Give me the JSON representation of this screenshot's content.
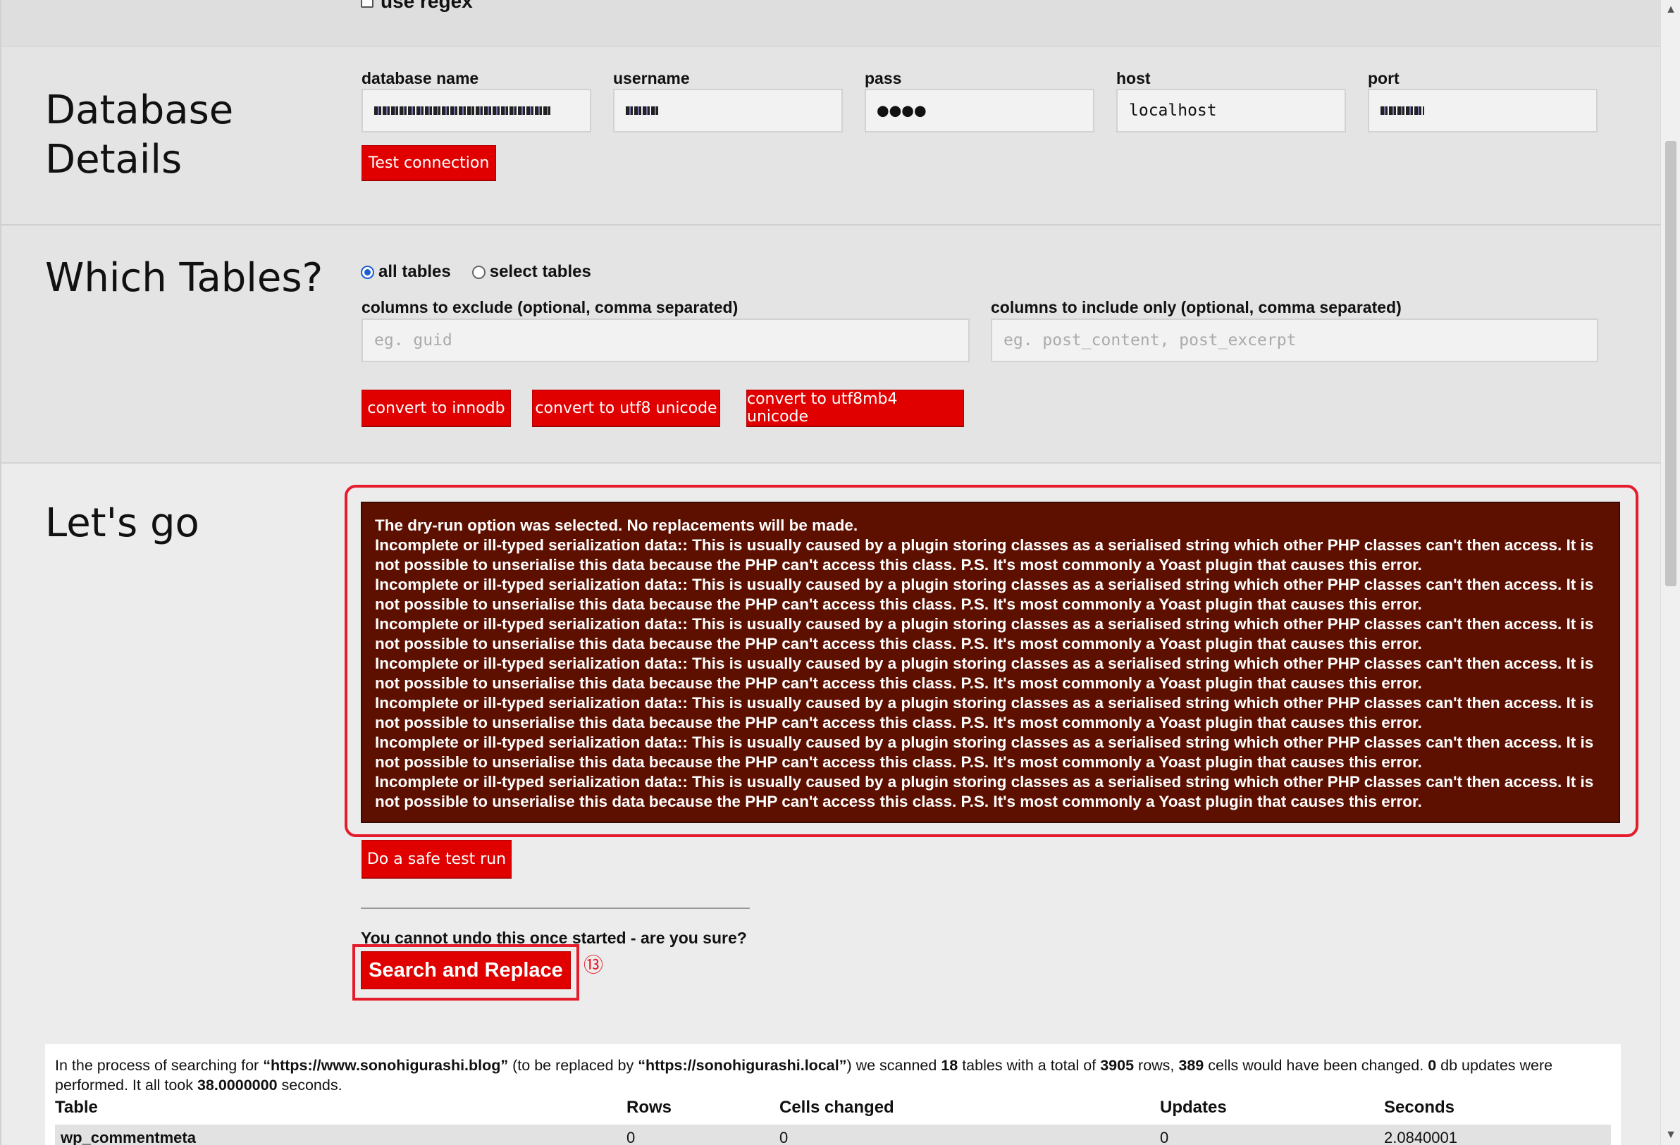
{
  "regex": {
    "label": "use regex"
  },
  "database": {
    "title_line1": "Database",
    "title_line2": "Details",
    "fields": {
      "name_label": "database name",
      "user_label": "username",
      "pass_label": "pass",
      "pass_value": "●●●●",
      "host_label": "host",
      "host_value": "localhost",
      "port_label": "port"
    },
    "test_button": "Test connection"
  },
  "tables": {
    "title": "Which Tables?",
    "radio_all": "all tables",
    "radio_select": "select tables",
    "exclude_label": "columns to exclude (optional, comma separated)",
    "exclude_placeholder": "eg. guid",
    "include_label": "columns to include only (optional, comma separated)",
    "include_placeholder": "eg. post_content, post_excerpt",
    "btn_innodb": "convert to innodb",
    "btn_utf8": "convert to utf8 unicode",
    "btn_utf8mb4": "convert to utf8mb4 unicode"
  },
  "go": {
    "title": "Let's go",
    "messages": [
      "The dry-run option was selected. No replacements will be made.",
      "Incomplete or ill-typed serialization data:: This is usually caused by a plugin storing classes as a serialised string which other PHP classes can't then access. It is not possible to unserialise this data because the PHP can't access this class. P.S. It's most commonly a Yoast plugin that causes this error.",
      "Incomplete or ill-typed serialization data:: This is usually caused by a plugin storing classes as a serialised string which other PHP classes can't then access. It is not possible to unserialise this data because the PHP can't access this class. P.S. It's most commonly a Yoast plugin that causes this error.",
      "Incomplete or ill-typed serialization data:: This is usually caused by a plugin storing classes as a serialised string which other PHP classes can't then access. It is not possible to unserialise this data because the PHP can't access this class. P.S. It's most commonly a Yoast plugin that causes this error.",
      "Incomplete or ill-typed serialization data:: This is usually caused by a plugin storing classes as a serialised string which other PHP classes can't then access. It is not possible to unserialise this data because the PHP can't access this class. P.S. It's most commonly a Yoast plugin that causes this error.",
      "Incomplete or ill-typed serialization data:: This is usually caused by a plugin storing classes as a serialised string which other PHP classes can't then access. It is not possible to unserialise this data because the PHP can't access this class. P.S. It's most commonly a Yoast plugin that causes this error.",
      "Incomplete or ill-typed serialization data:: This is usually caused by a plugin storing classes as a serialised string which other PHP classes can't then access. It is not possible to unserialise this data because the PHP can't access this class. P.S. It's most commonly a Yoast plugin that causes this error.",
      "Incomplete or ill-typed serialization data:: This is usually caused by a plugin storing classes as a serialised string which other PHP classes can't then access. It is not possible to unserialise this data because the PHP can't access this class. P.S. It's most commonly a Yoast plugin that causes this error."
    ],
    "safe_run_button": "Do a safe test run",
    "warning": "You cannot undo this once started - are you sure?",
    "search_replace_button": "Search and Replace",
    "marker": "⑬"
  },
  "report": {
    "t1": "In the process of searching for ",
    "search": "“https://www.sonohigurashi.blog”",
    "t2": " (to be replaced by ",
    "replace": "“https://sonohigurashi.local”",
    "t3": ") we scanned ",
    "tables_count": "18",
    "t4": " tables with a total of ",
    "rows_count": "3905",
    "t5": " rows, ",
    "cells_count": "389",
    "t6": " cells would have been changed. ",
    "updates_count": "0",
    "t7": " db updates were performed. It all took ",
    "seconds": "38.0000000",
    "t8": " seconds.",
    "columns": [
      "Table",
      "Rows",
      "Cells changed",
      "Updates",
      "Seconds"
    ],
    "rows": [
      [
        "wp_commentmeta",
        "0",
        "0",
        "0",
        "2.0840001"
      ]
    ]
  }
}
